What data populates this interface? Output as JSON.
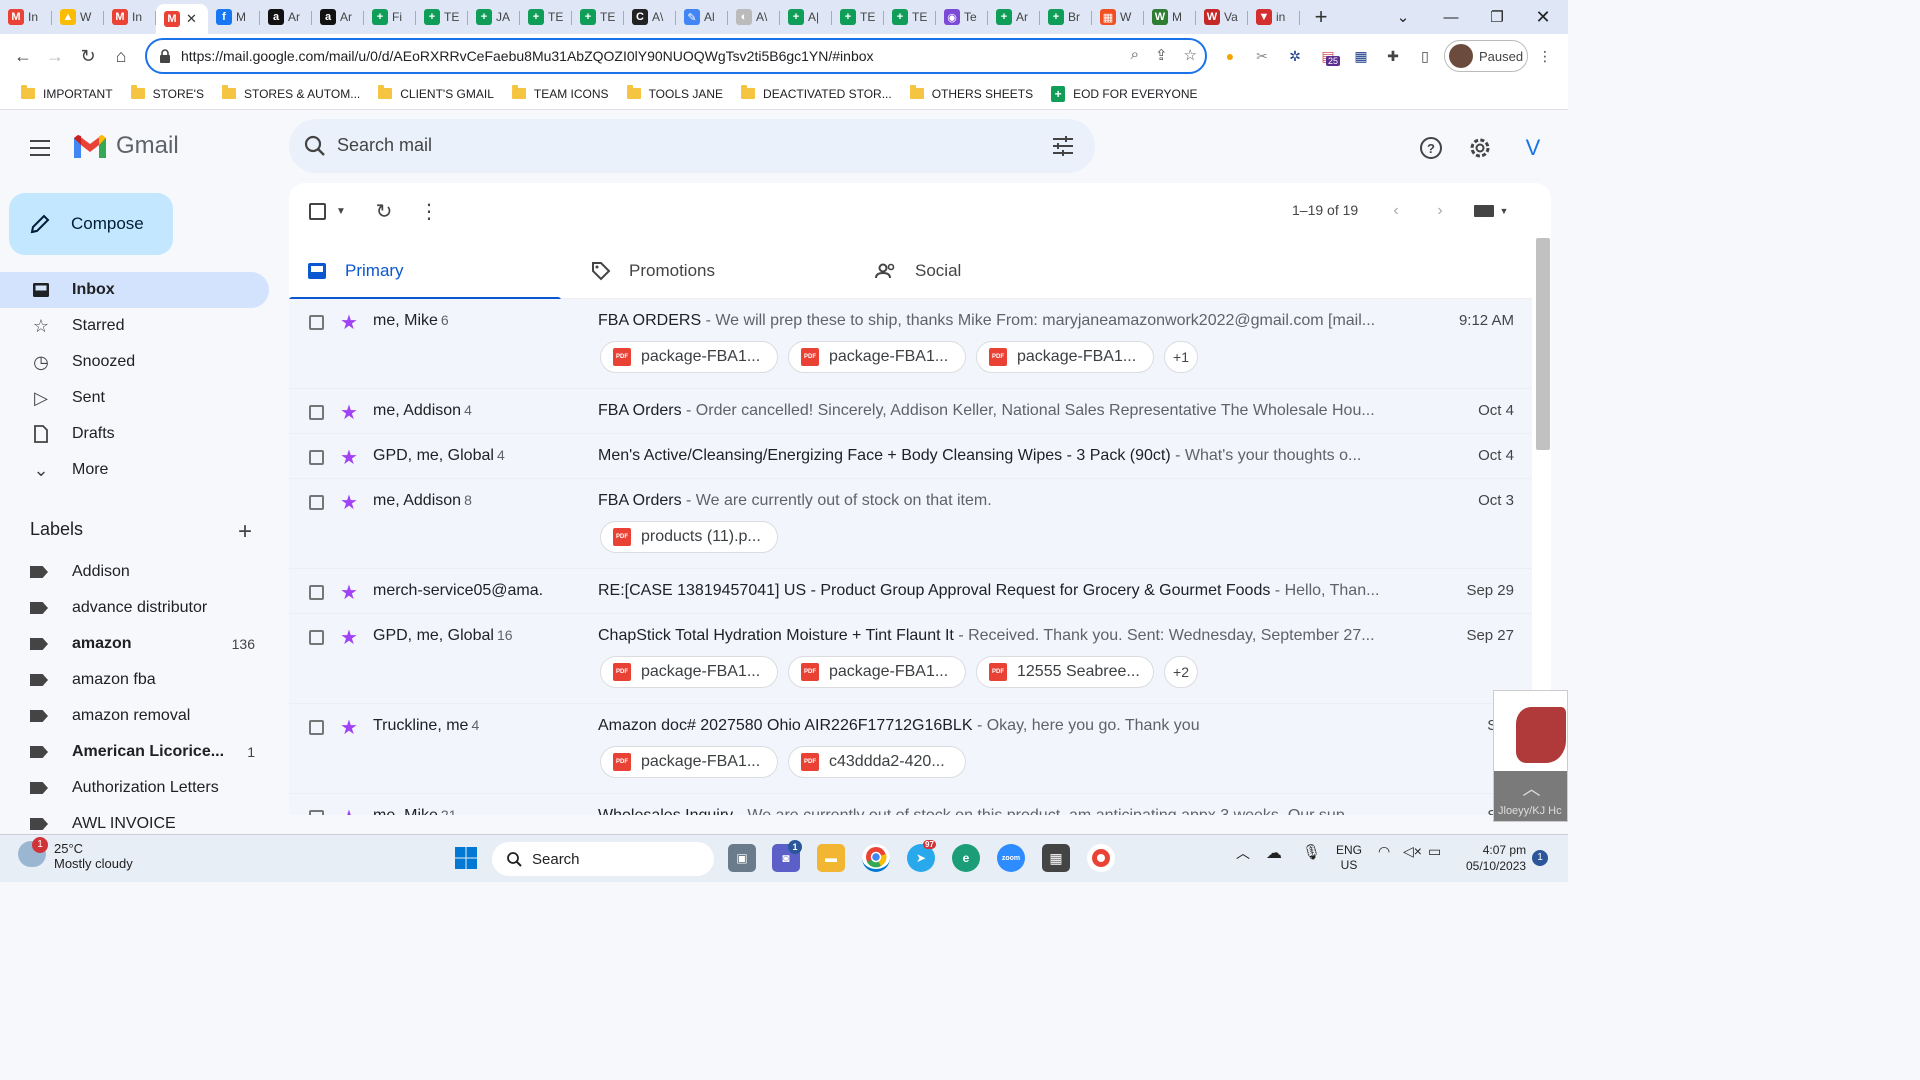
{
  "browser": {
    "tabs": [
      {
        "label": "In",
        "color": "#ea4335",
        "glyph": "M"
      },
      {
        "label": "W",
        "color": "#fbbc04",
        "glyph": "▲"
      },
      {
        "label": "In",
        "color": "#ea4335",
        "glyph": "M"
      },
      {
        "label": "",
        "color": "#ea4335",
        "glyph": "M",
        "active": true
      },
      {
        "label": "M",
        "color": "#1877f2",
        "glyph": "f"
      },
      {
        "label": "Ar",
        "color": "#111111",
        "glyph": "a"
      },
      {
        "label": "Ar",
        "color": "#111111",
        "glyph": "a"
      },
      {
        "label": "Fi",
        "color": "#0f9d58",
        "glyph": "+"
      },
      {
        "label": "TE",
        "color": "#0f9d58",
        "glyph": "+"
      },
      {
        "label": "JA",
        "color": "#0f9d58",
        "glyph": "+"
      },
      {
        "label": "TE",
        "color": "#0f9d58",
        "glyph": "+"
      },
      {
        "label": "TE",
        "color": "#0f9d58",
        "glyph": "+"
      },
      {
        "label": "A\\",
        "color": "#222222",
        "glyph": "C"
      },
      {
        "label": "Al",
        "color": "#4285f4",
        "glyph": "✎"
      },
      {
        "label": "A\\",
        "color": "#bbbbbb",
        "glyph": "◐"
      },
      {
        "label": "A|",
        "color": "#0f9d58",
        "glyph": "+"
      },
      {
        "label": "TE",
        "color": "#0f9d58",
        "glyph": "+"
      },
      {
        "label": "TE",
        "color": "#0f9d58",
        "glyph": "+"
      },
      {
        "label": "Te",
        "color": "#7b4bd8",
        "glyph": "◉"
      },
      {
        "label": "Ar",
        "color": "#0f9d58",
        "glyph": "+"
      },
      {
        "label": "Br",
        "color": "#0f9d58",
        "glyph": "+"
      },
      {
        "label": "W",
        "color": "#f25022",
        "glyph": "▦"
      },
      {
        "label": "M",
        "color": "#2e7d32",
        "glyph": "W"
      },
      {
        "label": "Va",
        "color": "#c62828",
        "glyph": "W"
      },
      {
        "label": "in",
        "color": "#d32f2f",
        "glyph": "▼"
      }
    ],
    "url": "https://mail.google.com/mail/u/0/d/AEoRXRRvCeFaebu8Mu31AbZQOZI0lY90NUOQWgTsv2ti5B6gc1YN/#inbox",
    "profile_label": "Paused",
    "ext_badge": "25",
    "bookmarks": [
      {
        "label": "IMPORTANT",
        "type": "folder"
      },
      {
        "label": "STORE'S",
        "type": "folder"
      },
      {
        "label": "STORES & AUTOM...",
        "type": "folder"
      },
      {
        "label": "CLIENT'S GMAIL",
        "type": "folder"
      },
      {
        "label": "TEAM ICONS",
        "type": "folder"
      },
      {
        "label": "TOOLS JANE",
        "type": "folder"
      },
      {
        "label": "DEACTIVATED STOR...",
        "type": "folder"
      },
      {
        "label": "OTHERS SHEETS",
        "type": "folder"
      },
      {
        "label": "EOD FOR EVERYONE",
        "type": "sheet"
      }
    ]
  },
  "gmail": {
    "logo_text": "Gmail",
    "search_placeholder": "Search mail",
    "avatar_letter": "V",
    "compose_label": "Compose",
    "nav": [
      {
        "label": "Inbox",
        "icon": "inbox-icon",
        "active": true
      },
      {
        "label": "Starred",
        "icon": "star-icon"
      },
      {
        "label": "Snoozed",
        "icon": "clock-icon"
      },
      {
        "label": "Sent",
        "icon": "send-icon"
      },
      {
        "label": "Drafts",
        "icon": "draft-icon"
      },
      {
        "label": "More",
        "icon": "chevron-down-icon"
      }
    ],
    "labels_title": "Labels",
    "labels": [
      {
        "name": "Addison",
        "bold": false,
        "count": ""
      },
      {
        "name": "advance distributor",
        "bold": false,
        "count": ""
      },
      {
        "name": "amazon",
        "bold": true,
        "count": "136"
      },
      {
        "name": "amazon fba",
        "bold": false,
        "count": ""
      },
      {
        "name": "amazon removal",
        "bold": false,
        "count": ""
      },
      {
        "name": "American Licorice...",
        "bold": true,
        "count": "1"
      },
      {
        "name": "Authorization Letters",
        "bold": false,
        "count": ""
      },
      {
        "name": "AWL INVOICE",
        "bold": false,
        "count": ""
      }
    ],
    "pager": "1–19 of 19",
    "tabs": [
      {
        "label": "Primary",
        "active": true
      },
      {
        "label": "Promotions"
      },
      {
        "label": "Social"
      }
    ],
    "emails": [
      {
        "sender": "me, Mike",
        "count": "6",
        "subject": "FBA ORDERS",
        "snippet": " - We will prep these to ship, thanks Mike From: maryjaneamazonwork2022@gmail.com [mail...",
        "date": "9:12 AM",
        "attachments": [
          "package-FBA1...",
          "package-FBA1...",
          "package-FBA1..."
        ],
        "more": "+1"
      },
      {
        "sender": "me, Addison",
        "count": "4",
        "subject": "FBA Orders",
        "snippet": " - Order cancelled! Sincerely, Addison Keller, National Sales Representative The Wholesale Hou...",
        "date": "Oct 4",
        "attachments": [],
        "more": ""
      },
      {
        "sender": "GPD, me, Global",
        "count": "4",
        "subject": "Men's Active/Cleansing/Energizing Face + Body Cleansing Wipes - 3 Pack (90ct)",
        "snippet": " - What's your thoughts o...",
        "date": "Oct 4",
        "attachments": [],
        "more": ""
      },
      {
        "sender": "me, Addison",
        "count": "8",
        "subject": "FBA Orders",
        "snippet": " - We are currently out of stock on that item.",
        "date": "Oct 3",
        "attachments": [
          "products (11).p..."
        ],
        "more": ""
      },
      {
        "sender": "merch-service05@ama.",
        "count": "",
        "subject": "RE:[CASE 13819457041] US - Product Group Approval Request for Grocery & Gourmet Foods",
        "snippet": " - Hello, Than...",
        "date": "Sep 29",
        "attachments": [],
        "more": ""
      },
      {
        "sender": "GPD, me, Global",
        "count": "16",
        "subject": "ChapStick Total Hydration Moisture + Tint Flaunt It",
        "snippet": " - Received. Thank you. Sent: Wednesday, September 27...",
        "date": "Sep 27",
        "attachments": [
          "package-FBA1...",
          "package-FBA1...",
          "12555 Seabree..."
        ],
        "more": "+2"
      },
      {
        "sender": "Truckline, me",
        "count": "4",
        "subject": "Amazon doc# 2027580 Ohio AIR226F17712G16BLK",
        "snippet": " - Okay, here you go. Thank you",
        "date": "Sep",
        "attachments": [
          "package-FBA1...",
          "c43ddda2-420..."
        ],
        "more": ""
      },
      {
        "sender": "me, Mike",
        "count": "21",
        "subject": "Wholesales Inquiry",
        "snippet": " - We are currently out of stock on this product, am anticipating appx 3 weeks. Our sup...",
        "date": "Sep",
        "attachments": [],
        "more": ""
      }
    ],
    "thumb_caption": "Jloeyy/KJ Hc"
  },
  "taskbar": {
    "temp": "25°C",
    "weather": "Mostly cloudy",
    "weather_badge": "1",
    "search_label": "Search",
    "lang1": "ENG",
    "lang2": "US",
    "time": "4:07 pm",
    "date": "05/10/2023",
    "notif_count": "1",
    "telegram_badge": "97",
    "teams_badge": "1"
  }
}
